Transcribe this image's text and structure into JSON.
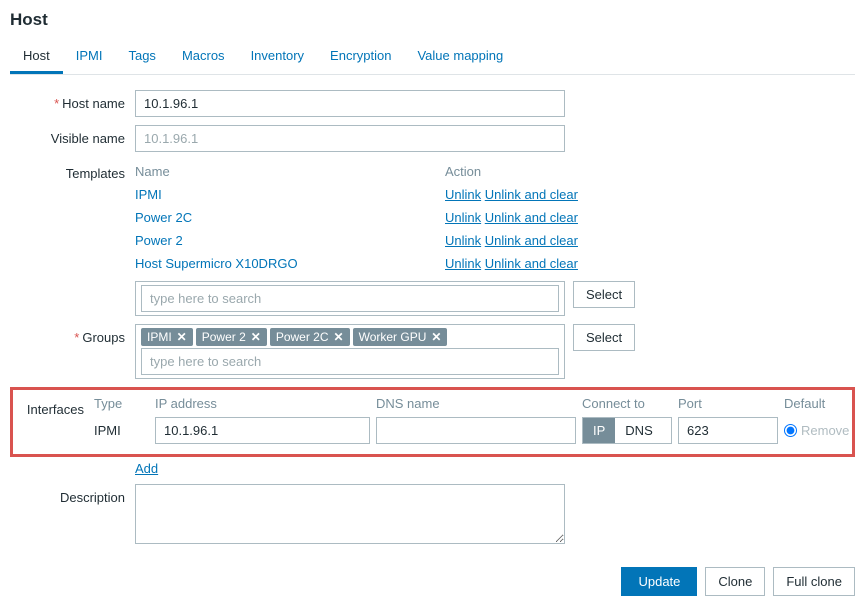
{
  "page_title": "Host",
  "tabs": [
    "Host",
    "IPMI",
    "Tags",
    "Macros",
    "Inventory",
    "Encryption",
    "Value mapping"
  ],
  "active_tab": 0,
  "labels": {
    "host_name": "Host name",
    "visible_name": "Visible name",
    "templates": "Templates",
    "groups": "Groups",
    "interfaces": "Interfaces",
    "description": "Description",
    "name_col": "Name",
    "action_col": "Action",
    "type_col": "Type",
    "ip_col": "IP address",
    "dns_col": "DNS name",
    "connect_col": "Connect to",
    "port_col": "Port",
    "default_col": "Default"
  },
  "host_name": "10.1.96.1",
  "visible_name_placeholder": "10.1.96.1",
  "templates_list": [
    {
      "name": "IPMI"
    },
    {
      "name": "Power 2C"
    },
    {
      "name": "Power 2"
    },
    {
      "name": "Host Supermicro X10DRGO"
    }
  ],
  "template_actions": {
    "unlink": "Unlink",
    "unlink_clear": "Unlink and clear"
  },
  "search_placeholder": "type here to search",
  "select_btn": "Select",
  "groups": [
    "IPMI",
    "Power 2",
    "Power 2C",
    "Worker GPU"
  ],
  "interface": {
    "type": "IPMI",
    "ip": "10.1.96.1",
    "dns": "",
    "connect_ip": "IP",
    "connect_dns": "DNS",
    "port": "623",
    "remove": "Remove"
  },
  "add_link": "Add",
  "footer": {
    "update": "Update",
    "clone": "Clone",
    "full_clone": "Full clone"
  }
}
